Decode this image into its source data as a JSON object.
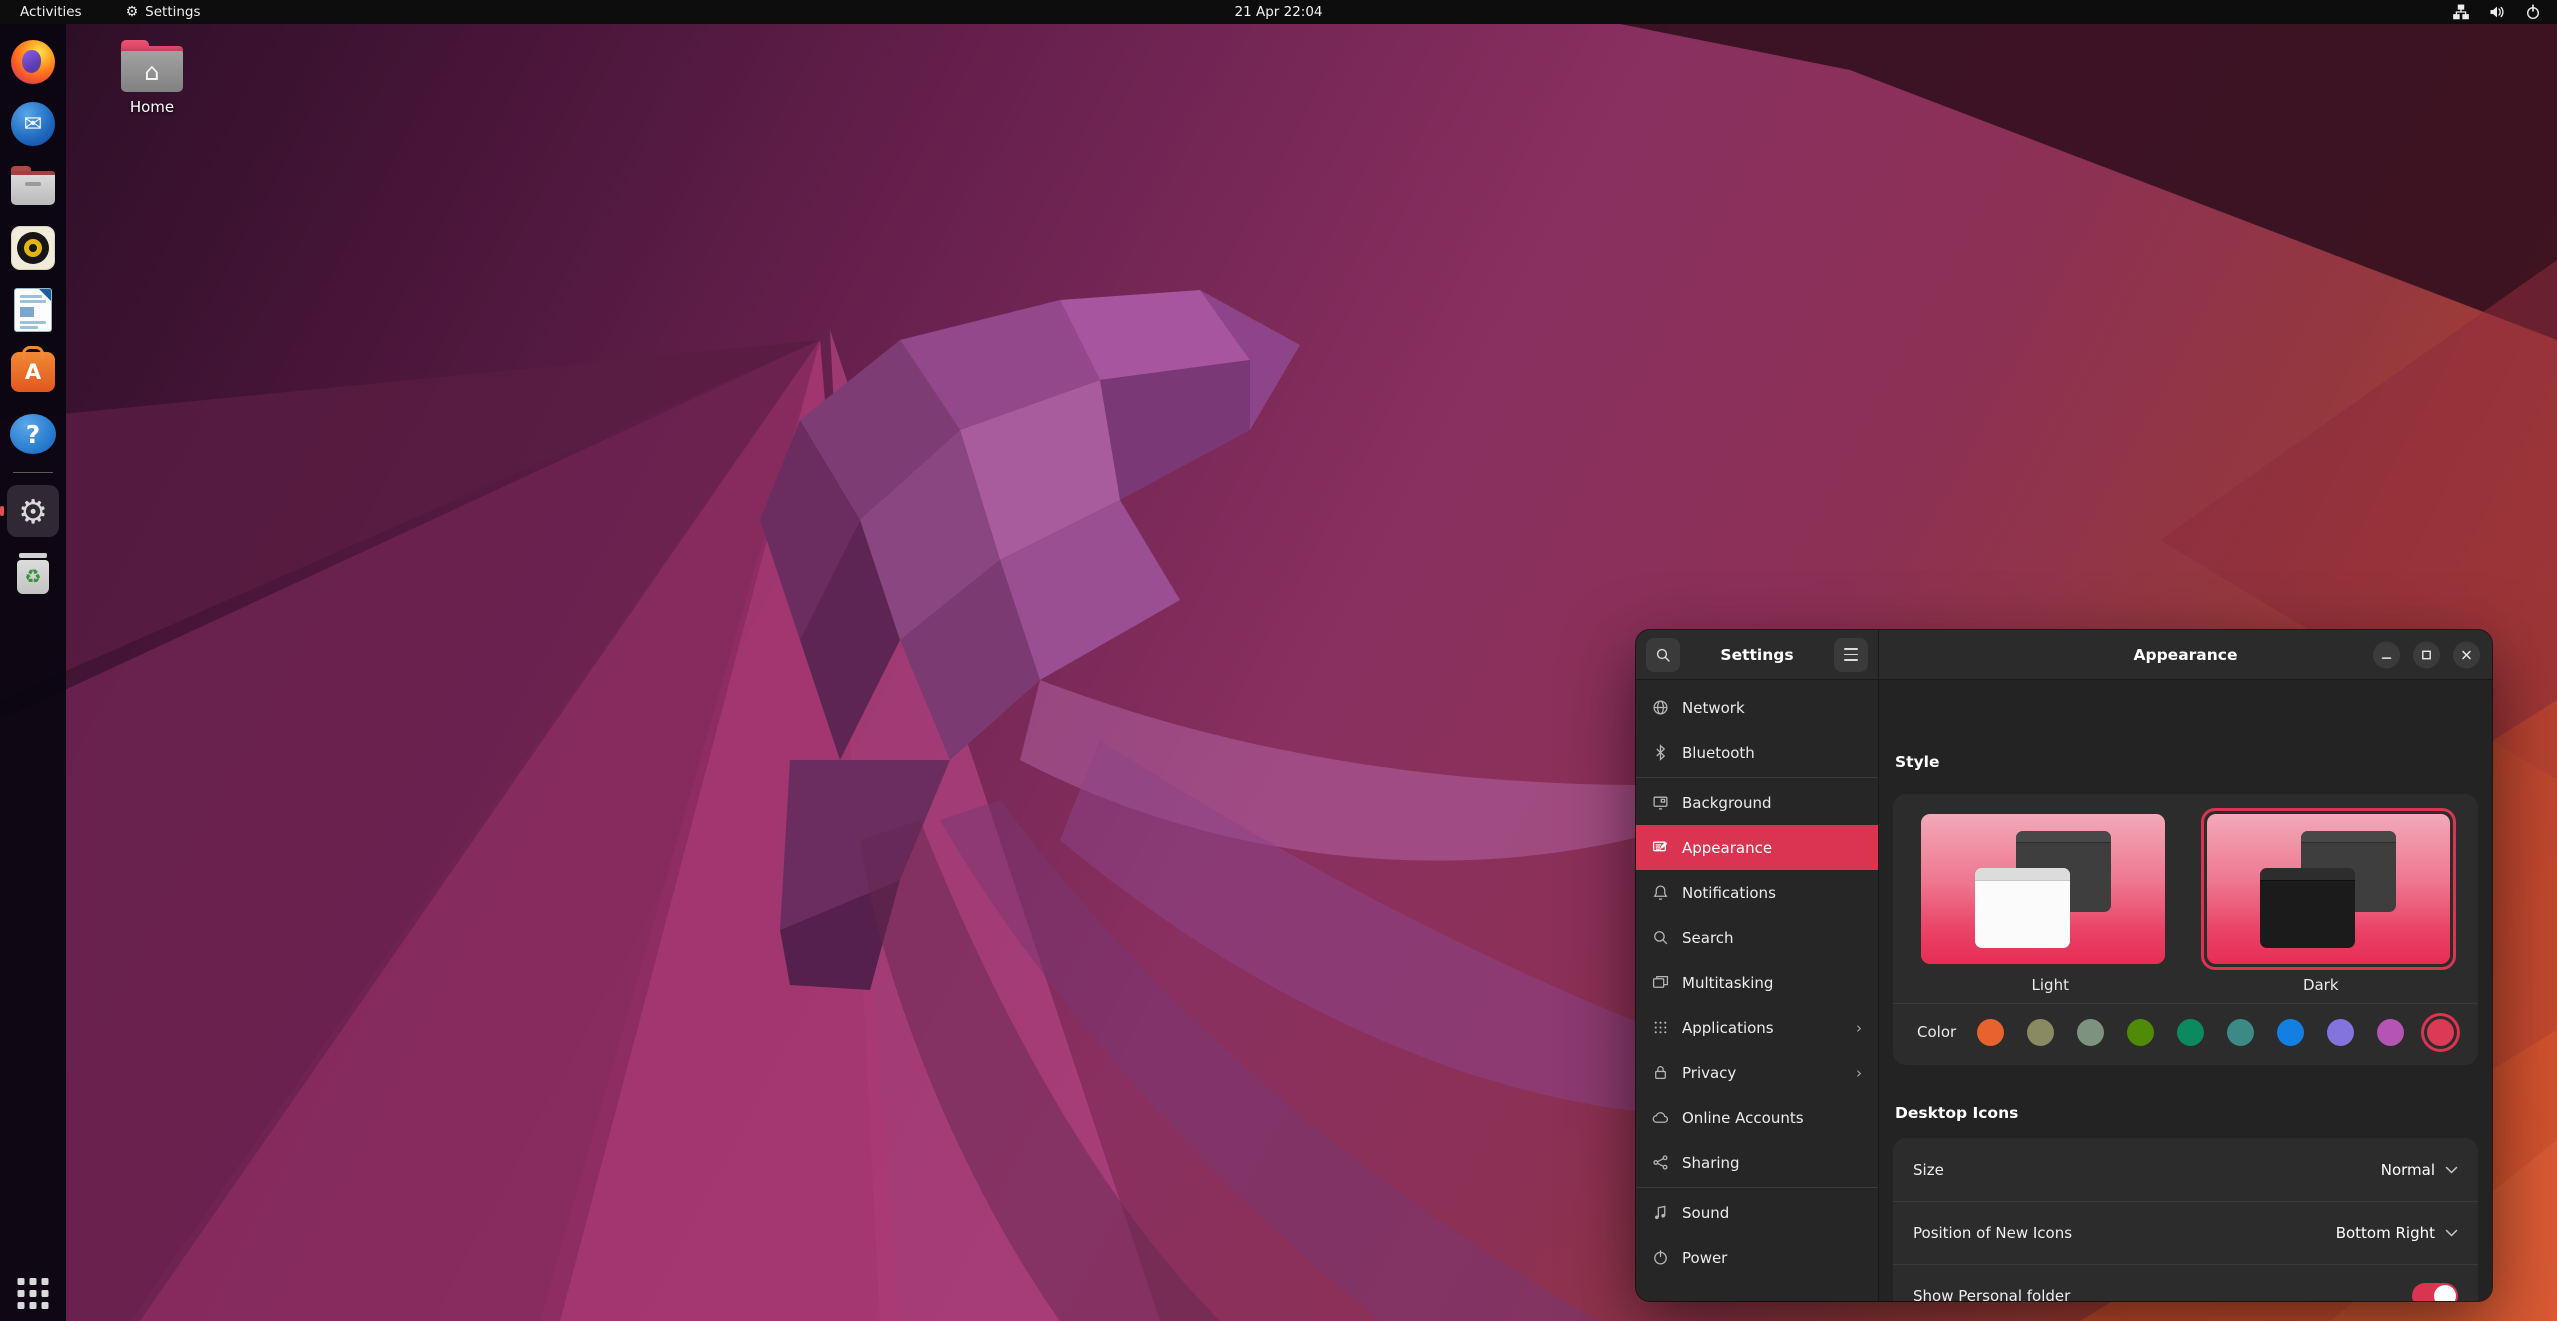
{
  "topbar": {
    "activities_label": "Activities",
    "focused_app_label": "Settings",
    "clock": "21 Apr 22:04",
    "tray_icons": [
      "network-icon",
      "volume-icon",
      "power-icon"
    ]
  },
  "desktop": {
    "home_icon_label": "Home"
  },
  "dock": {
    "apps": [
      "firefox",
      "thunderbird",
      "files",
      "rhythmbox",
      "libreoffice-writer",
      "ubuntu-software",
      "help",
      "settings",
      "trash"
    ],
    "running_app": "settings",
    "show_apps_icon": "show-apps-grid"
  },
  "settings_window": {
    "sidebar": {
      "title": "Settings",
      "items": [
        {
          "label": "Network",
          "icon": "globe-icon"
        },
        {
          "label": "Bluetooth",
          "icon": "bluetooth-icon"
        },
        {
          "label": "Background",
          "icon": "display-icon"
        },
        {
          "label": "Appearance",
          "icon": "appearance-icon",
          "selected": true
        },
        {
          "label": "Notifications",
          "icon": "bell-icon"
        },
        {
          "label": "Search",
          "icon": "magnifier-icon"
        },
        {
          "label": "Multitasking",
          "icon": "windows-icon"
        },
        {
          "label": "Applications",
          "icon": "app-grid-icon",
          "chevron": true
        },
        {
          "label": "Privacy",
          "icon": "lock-icon",
          "chevron": true
        },
        {
          "label": "Online Accounts",
          "icon": "cloud-icon"
        },
        {
          "label": "Sharing",
          "icon": "share-icon"
        },
        {
          "label": "Sound",
          "icon": "music-note-icon"
        },
        {
          "label": "Power",
          "icon": "power-icon"
        }
      ]
    },
    "titlebar": {
      "title": "Appearance",
      "controls": [
        "minimize",
        "maximize",
        "close"
      ]
    },
    "style_section": {
      "heading": "Style",
      "options": [
        {
          "label": "Light",
          "selected": false
        },
        {
          "label": "Dark",
          "selected": true
        }
      ],
      "color_row": {
        "label": "Color",
        "selected_color": "red",
        "swatches": [
          {
            "name": "orange",
            "hex": "#E8622D"
          },
          {
            "name": "bark",
            "hex": "#8A8A62"
          },
          {
            "name": "sage",
            "hex": "#7D937F"
          },
          {
            "name": "olive",
            "hex": "#4F8B06"
          },
          {
            "name": "viridian",
            "hex": "#0B8A5F"
          },
          {
            "name": "prussian-green",
            "hex": "#3C8A85"
          },
          {
            "name": "blue",
            "hex": "#147FE3"
          },
          {
            "name": "purple",
            "hex": "#8374DD"
          },
          {
            "name": "magenta",
            "hex": "#B455B4"
          },
          {
            "name": "red",
            "hex": "#DB3A55",
            "selected": true
          }
        ]
      }
    },
    "desktop_icons_section": {
      "heading": "Desktop Icons",
      "rows": [
        {
          "label": "Size",
          "value": "Normal",
          "control": "dropdown"
        },
        {
          "label": "Position of New Icons",
          "value": "Bottom Right",
          "control": "dropdown"
        },
        {
          "label": "Show Personal folder",
          "control": "toggle",
          "state": "on"
        }
      ]
    }
  },
  "theme": {
    "accent": "#DA3450",
    "style_preview_gradient_top": "#F2A9B8",
    "style_preview_gradient_bottom": "#E72D54"
  }
}
